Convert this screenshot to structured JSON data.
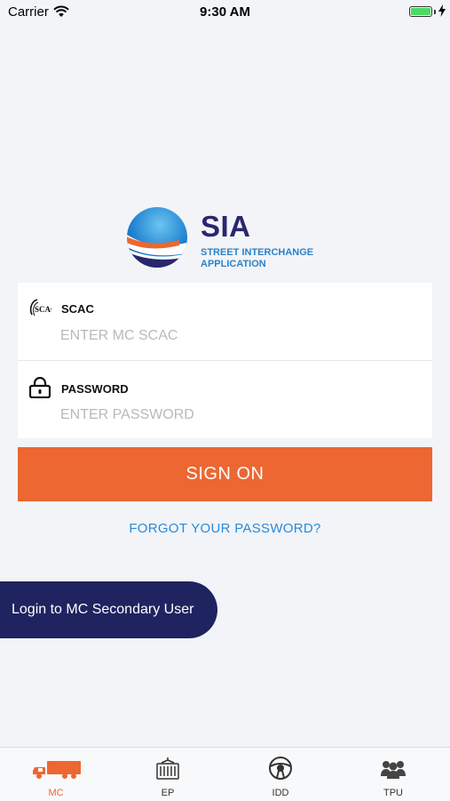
{
  "status_bar": {
    "carrier": "Carrier",
    "time": "9:30 AM",
    "battery_level": 1.0
  },
  "logo": {
    "title": "SIA",
    "subtitle_line1": "STREET INTERCHANGE",
    "subtitle_line2": "APPLICATION"
  },
  "form": {
    "scac_label": "SCAC",
    "scac_placeholder": "ENTER MC SCAC",
    "scac_value": "",
    "password_label": "PASSWORD",
    "password_placeholder": "ENTER PASSWORD",
    "password_value": ""
  },
  "actions": {
    "sign_on": "SIGN ON",
    "forgot_password": "FORGOT YOUR PASSWORD?",
    "secondary_login": "Login to MC Secondary User"
  },
  "tab_bar": {
    "active": "MC",
    "items": [
      {
        "label": "MC",
        "icon": "truck-icon"
      },
      {
        "label": "EP",
        "icon": "container-icon"
      },
      {
        "label": "IDD",
        "icon": "steering-wheel-icon"
      },
      {
        "label": "TPU",
        "icon": "users-group-icon"
      }
    ]
  },
  "colors": {
    "accent": "#ec6732",
    "navy": "#1f2360",
    "link": "#2a8ad8",
    "background": "#f2f4f8"
  }
}
